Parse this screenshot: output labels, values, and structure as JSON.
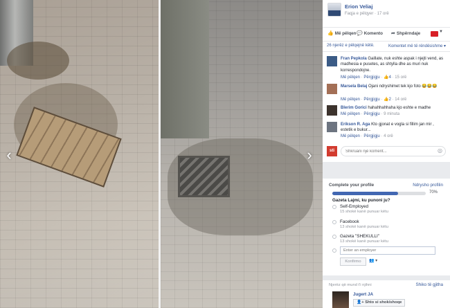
{
  "viewer": {
    "prev_arrow": "‹",
    "next_arrow": "›"
  },
  "post": {
    "author": "Erion Veliaj",
    "subtitle": "Faqja e pëlqyer · 17 orë"
  },
  "actions": {
    "like": "Më pëlqen",
    "comment": "Komento",
    "share": "Shpërndaje",
    "like_icon": "thumbs-up-icon",
    "comment_icon": "speech-bubble-icon",
    "share_icon": "share-arrow-icon"
  },
  "stats": {
    "likes": "26 njerëz e pëlqejnë këtë.",
    "sort": "Komentet më të rëndësishme ▾"
  },
  "comments": [
    {
      "name": "Fran Pepkola",
      "text": "Gaillate, nuk eshte aspak i njejti vend, as madhesia e pusetes, as shtylla dhe as muri nuk korrespondojne.",
      "like": "Më pëlqen",
      "reply": "Përgjigju",
      "likes": "4",
      "time": "15 orë"
    },
    {
      "name": "Marsela Belaj",
      "text": "Ojani ndryshimet tek kjo foto 😂😂😂",
      "like": "Më pëlqen",
      "reply": "Përgjigju",
      "likes": "2",
      "time": "14 orë"
    },
    {
      "name": "Blerim Gorici",
      "text": "hahahhahhaha kjo eshte e madhe",
      "like": "Më pëlqen",
      "reply": "Përgjigju",
      "likes": "",
      "time": "9 minuta"
    },
    {
      "name": "Erikson R. Aga",
      "text": "Kto gjonat e vogla si fillim jan mir , estetik e bukur...",
      "like": "Më pëlqen",
      "reply": "Përgjigju",
      "likes": "",
      "time": "4 orë"
    }
  ],
  "composer": {
    "avatar_text": "sti",
    "placeholder": "Shkruani një koment...",
    "camera_icon": "camera-icon"
  },
  "profile": {
    "title": "Complete your profile",
    "link": "Ndrysho profilin",
    "progress": 0.7,
    "percent": "70%",
    "question": "Gazeta Lajmi, ku punoni ju?",
    "options": [
      {
        "label": "Self-Employed",
        "sub": "15 shokë kanë punuar këtu"
      },
      {
        "label": "Facebook",
        "sub": "13 shokë kanë punuar këtu"
      },
      {
        "label": "Gazeta \"SHEKULLI\"",
        "sub": "13 shokë kanë punuar këtu"
      }
    ],
    "employer_placeholder": "Enter an employer",
    "confirm": "Konfirmo",
    "privacy": "👥 ▾"
  },
  "pymk": {
    "title": "Njerëz që mund t'i njihni",
    "link": "Shiko të gjitha",
    "name": "Jugert JA",
    "add": "Shto si shok/shoqe"
  },
  "colors": {
    "link": "#365899",
    "brand": "#4267b2",
    "flag": "#d81f26"
  }
}
